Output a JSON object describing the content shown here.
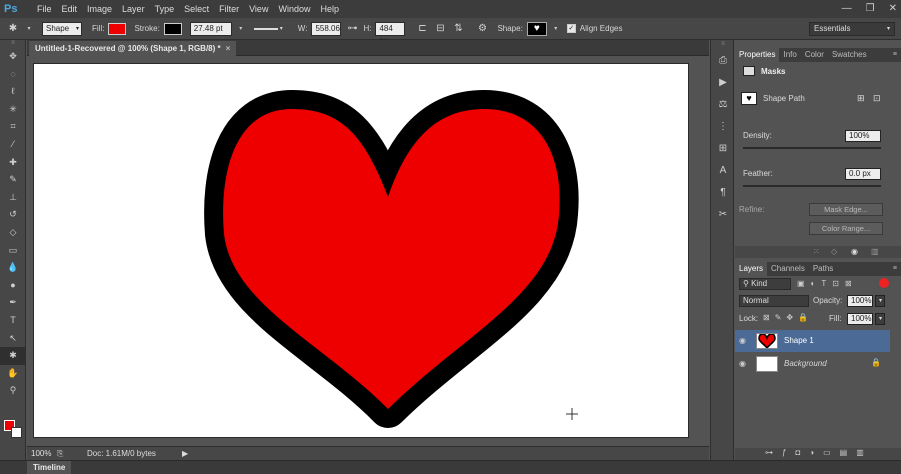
{
  "app": {
    "logo": "Ps"
  },
  "menu": [
    "File",
    "Edit",
    "Image",
    "Layer",
    "Type",
    "Select",
    "Filter",
    "View",
    "Window",
    "Help"
  ],
  "window_controls": [
    "—",
    "❐",
    "✕"
  ],
  "options": {
    "mode": "Shape",
    "fill_label": "Fill:",
    "fill_color": "#ee0000",
    "stroke_label": "Stroke:",
    "stroke_width": "27.48 pt",
    "w_label": "W:",
    "w_value": "558.06",
    "h_label": "H:",
    "h_value": "484 px",
    "shape_label": "Shape:",
    "align_edges": "Align Edges",
    "workspace": "Essentials"
  },
  "document": {
    "tab_title": "Untitled-1-Recovered @ 100% (Shape 1, RGB/8) *",
    "close": "×"
  },
  "status": {
    "zoom": "100%",
    "doc": "Doc: 1.61M/0 bytes",
    "arrow": "▶"
  },
  "timeline": {
    "label": "Timeline"
  },
  "properties": {
    "tabs": [
      "Properties",
      "Info",
      "Color",
      "Swatches"
    ],
    "masks_title": "Masks",
    "shape_path": "Shape Path",
    "density_label": "Density:",
    "density_value": "100%",
    "feather_label": "Feather:",
    "feather_value": "0.0 px",
    "refine_label": "Refine:",
    "mask_edge": "Mask Edge...",
    "color_range": "Color Range..."
  },
  "layers_panel": {
    "tabs": [
      "Layers",
      "Channels",
      "Paths"
    ],
    "kind": "Kind",
    "blend": "Normal",
    "opacity_label": "Opacity:",
    "opacity_value": "100%",
    "lock_label": "Lock:",
    "fill_label": "Fill:",
    "fill_value": "100%",
    "layers": [
      {
        "name": "Shape 1",
        "selected": true
      },
      {
        "name": "Background",
        "selected": false
      }
    ]
  },
  "colors": {
    "fill": "#ee0000",
    "stroke": "#000000",
    "foreground": "#ee0000",
    "background": "#ffffff",
    "selection": "#4b6a96"
  }
}
